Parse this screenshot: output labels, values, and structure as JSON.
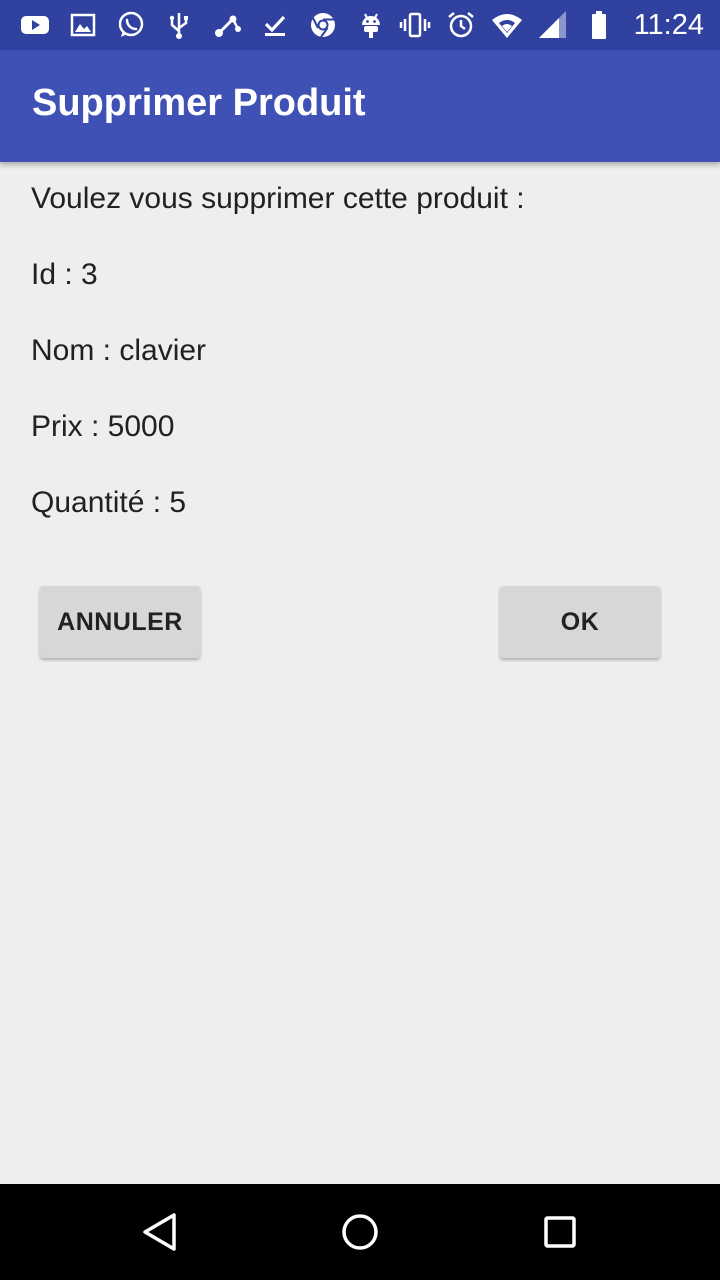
{
  "status_bar": {
    "time": "11:24",
    "left_icons": [
      "youtube-icon",
      "gallery-icon",
      "whatsapp-icon",
      "usb-icon",
      "connection-icon",
      "download-done-icon",
      "chrome-icon",
      "android-icon"
    ],
    "right_icons": [
      "vibrate-icon",
      "alarm-icon",
      "wifi-icon",
      "cell-signal-icon",
      "battery-icon"
    ]
  },
  "app_bar": {
    "title": "Supprimer Produit"
  },
  "content": {
    "question": "Voulez vous supprimer cette produit :",
    "id_line": "Id : 3",
    "nom_line": "Nom : clavier",
    "prix_line": "Prix : 5000",
    "quantite_line": "Quantité : 5"
  },
  "actions": {
    "cancel_label": "ANNULER",
    "ok_label": "OK"
  },
  "nav_bar": {
    "icons": [
      "back-icon",
      "home-icon",
      "recents-icon"
    ]
  },
  "colors": {
    "status_bar": "#3041a0",
    "app_bar": "#3f51b5",
    "background": "#eeeeee",
    "button": "#d6d7d7",
    "nav_bar": "#000000"
  }
}
